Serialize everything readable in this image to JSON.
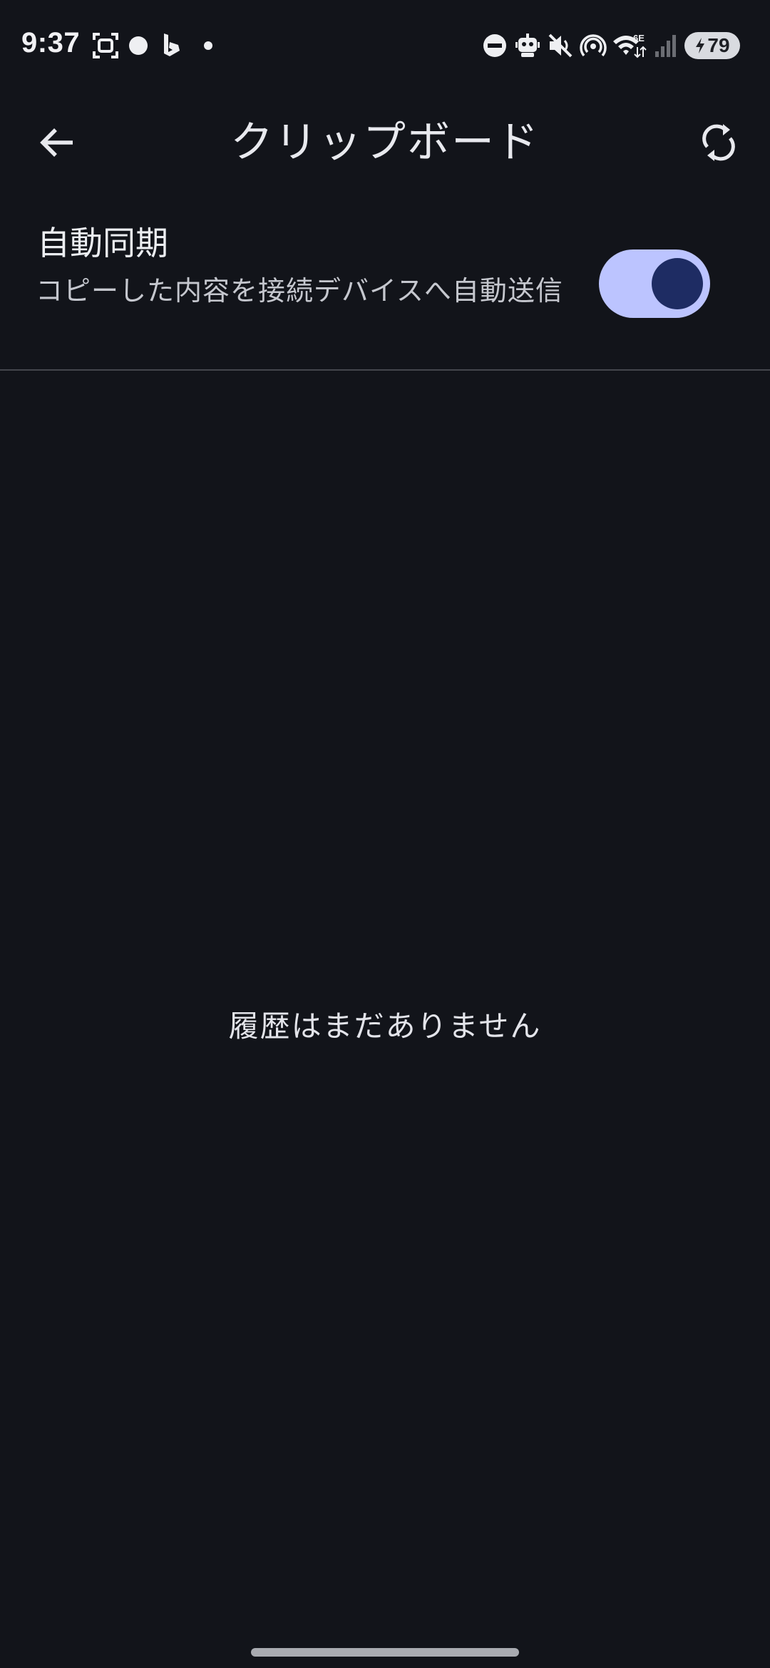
{
  "status_bar": {
    "time": "9:37",
    "battery_level": "79",
    "network_label": "6E",
    "icons": [
      "screenshot-icon",
      "record-dot-icon",
      "bing-icon",
      "notification-dot-icon",
      "do-not-disturb-icon",
      "robot-icon",
      "mute-icon",
      "hotspot-icon",
      "wifi-6e-icon",
      "cell-signal-icon",
      "battery-charging-icon"
    ]
  },
  "app_bar": {
    "title": "クリップボード",
    "back_icon": "arrow-back-icon",
    "sync_icon": "sync-icon"
  },
  "auto_sync": {
    "title": "自動同期",
    "description": "コピーした内容を接続デバイスへ自動送信",
    "enabled": true
  },
  "history": {
    "empty_message": "履歴はまだありません"
  },
  "colors": {
    "background": "#12141a",
    "toggle_track": "#bcc4ff",
    "toggle_thumb": "#1e2c63",
    "text_primary": "#e8e9ee",
    "text_secondary": "#c5c7ce",
    "divider": "#44464d"
  }
}
